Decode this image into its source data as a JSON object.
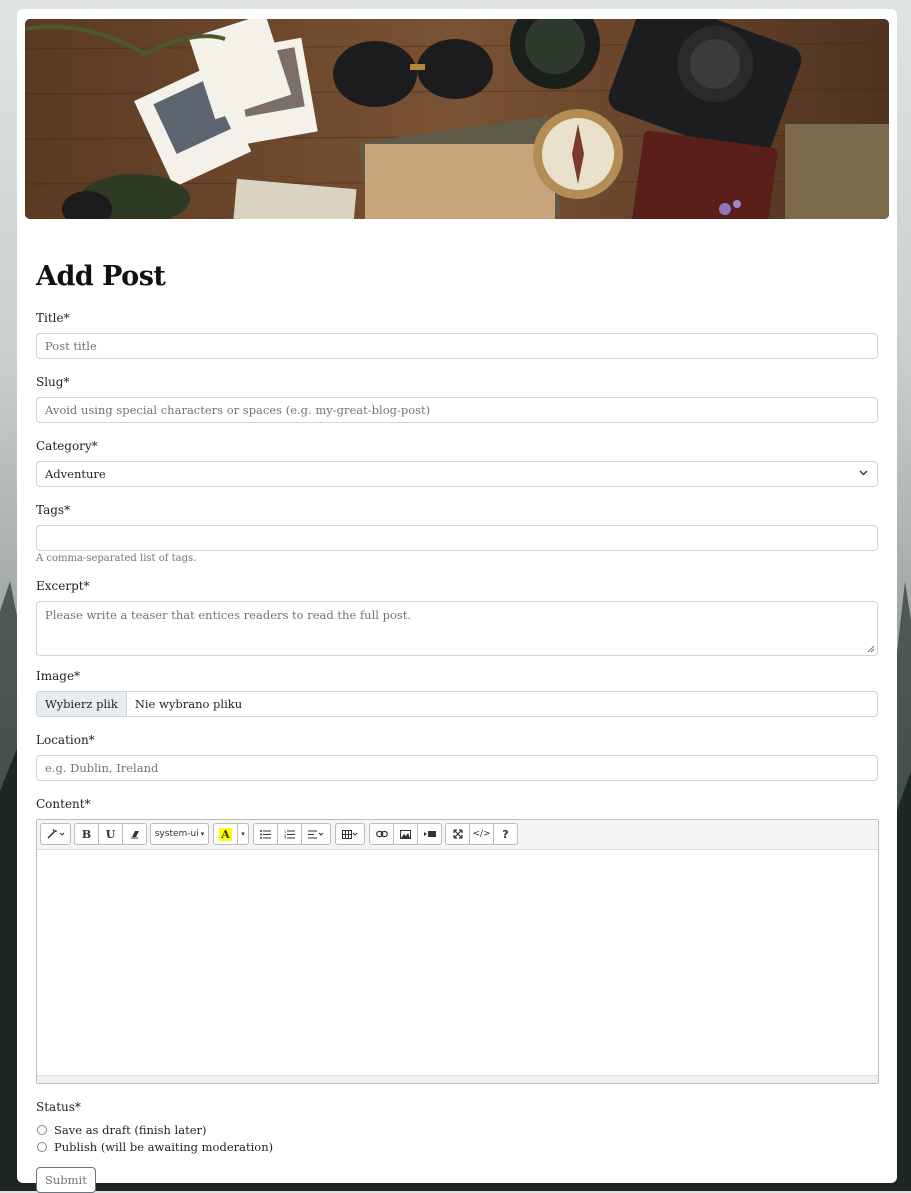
{
  "page": {
    "title": "Add Post"
  },
  "fields": {
    "title": {
      "label": "Title*",
      "placeholder": "Post title"
    },
    "slug": {
      "label": "Slug*",
      "placeholder": "Avoid using special characters or spaces (e.g. my-great-blog-post)"
    },
    "category": {
      "label": "Category*",
      "value": "Adventure"
    },
    "tags": {
      "label": "Tags*",
      "help": "A comma-separated list of tags."
    },
    "excerpt": {
      "label": "Excerpt*",
      "placeholder": "Please write a teaser that entices readers to read the full post."
    },
    "image": {
      "label": "Image*",
      "button": "Wybierz plik",
      "status": "Nie wybrano pliku"
    },
    "location": {
      "label": "Location*",
      "placeholder": "e.g. Dublin, Ireland"
    },
    "content": {
      "label": "Content*"
    }
  },
  "editor": {
    "toolbar": {
      "style": "style-icon",
      "bold": "B",
      "underline": "U",
      "clear": "eraser-icon",
      "font_name": "system-ui",
      "color": "A",
      "ul": "unordered-list-icon",
      "ol": "ordered-list-icon",
      "paragraph": "align-icon",
      "table": "table-icon",
      "link": "link-icon",
      "picture": "picture-icon",
      "video": "video-icon",
      "fullscreen": "fullscreen-icon",
      "codeview": "</>",
      "help": "?"
    }
  },
  "status": {
    "label": "Status*",
    "options": [
      "Save as draft (finish later)",
      "Publish (will be awaiting moderation)"
    ]
  },
  "submit": {
    "label": "Submit"
  },
  "colors": {
    "highlight": "#ffff00",
    "border": "#ced4da",
    "muted": "#6c757d"
  }
}
